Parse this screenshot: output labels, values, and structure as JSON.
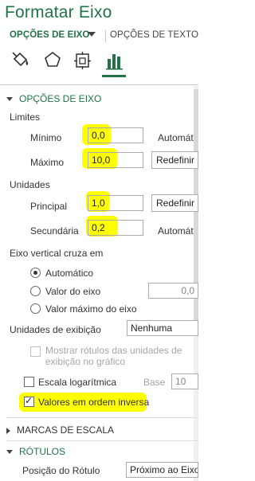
{
  "panel": {
    "title": "Formatar Eixo",
    "tab_active": "OPÇÕES DE EIXO",
    "tab_other": "OPÇÕES DE TEXTO"
  },
  "icons": [
    "fill-bucket-icon",
    "pentagon-icon",
    "size-properties-icon",
    "bar-chart-icon"
  ],
  "colors": {
    "accent": "#217346",
    "highlight": "#ffff00"
  },
  "axis_options": {
    "heading": "OPÇÕES DE EIXO",
    "limits": {
      "label": "Limites",
      "min_label": "Mínimo",
      "min_value": "0,0",
      "min_action": "Automát",
      "max_label": "Máximo",
      "max_value": "10,0",
      "max_action": "Redefinir"
    },
    "units": {
      "label": "Unidades",
      "major_label": "Principal",
      "major_value": "1,0",
      "major_action": "Redefinir",
      "minor_label": "Secundária",
      "minor_value": "0,2",
      "minor_action": "Automát"
    },
    "crosses": {
      "label": "Eixo vertical cruza em",
      "auto_label": "Automático",
      "value_label": "Valor do eixo",
      "value_input": "0,0",
      "max_label": "Valor máximo do eixo"
    },
    "display_units": {
      "label": "Unidades de exibição",
      "value": "Nenhuma",
      "show_label_line1": "Mostrar rótulos das unidades de",
      "show_label_line2": "exibição no gráfico"
    },
    "log_scale": {
      "label": "Escala logarítmica",
      "base_label": "Base",
      "base_value": "10"
    },
    "reverse": {
      "label": "Valores em ordem inversa"
    }
  },
  "tick_marks": {
    "heading": "MARCAS DE ESCALA"
  },
  "labels_section": {
    "heading": "RÓTULOS",
    "position_label": "Posição do Rótulo",
    "position_value": "Próximo ao Eixo"
  }
}
